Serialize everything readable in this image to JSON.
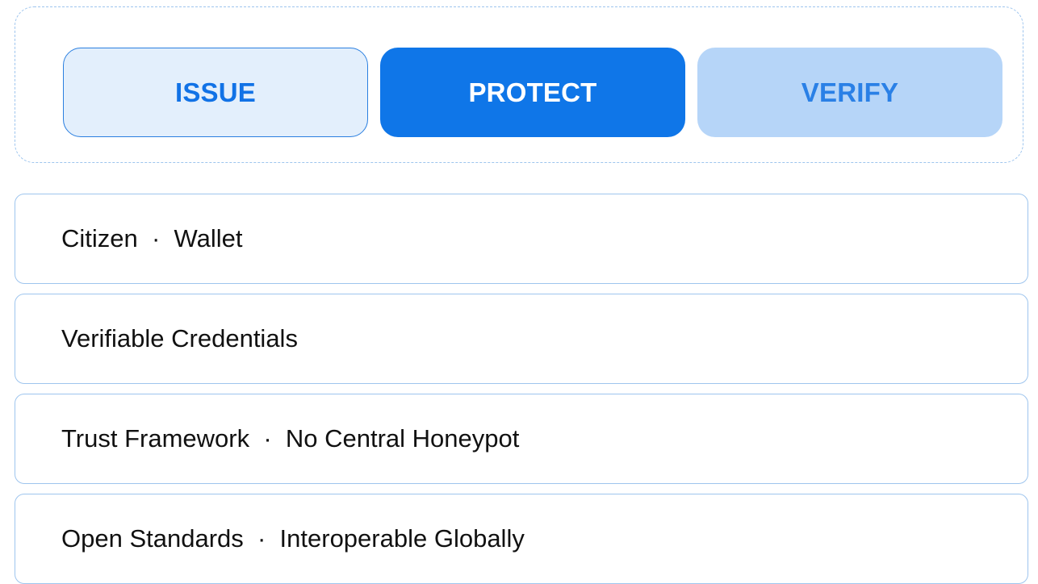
{
  "phases": {
    "issue": "ISSUE",
    "protect": "PROTECT",
    "verify": "VERIFY"
  },
  "layers": [
    "Citizen  ·  Wallet",
    "Verifiable Credentials",
    "Trust Framework  ·  No Central Honeypot",
    "Open Standards  ·  Interoperable Globally"
  ],
  "colors": {
    "primary": "#0f76e8",
    "issue_fill": "#e3effc",
    "verify_fill": "#b6d5f8",
    "border": "#9ec5ee"
  }
}
